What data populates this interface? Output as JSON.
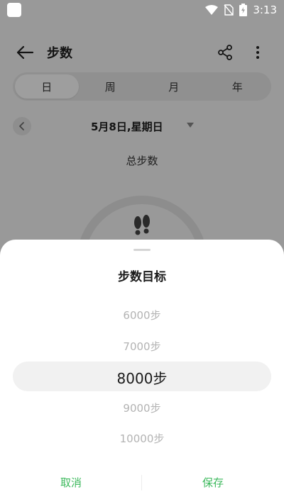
{
  "status_bar": {
    "time": "3:13"
  },
  "app_bar": {
    "title": "步数"
  },
  "tabs": [
    {
      "label": "日",
      "active": true
    },
    {
      "label": "周",
      "active": false
    },
    {
      "label": "月",
      "active": false
    },
    {
      "label": "年",
      "active": false
    }
  ],
  "date": {
    "label": "5月8日,星期日"
  },
  "summary": {
    "total_label": "总步数"
  },
  "sheet": {
    "title": "步数目标",
    "options": [
      "6000步",
      "7000步",
      "8000步",
      "9000步",
      "10000步"
    ],
    "selected": "8000步",
    "cancel_label": "取消",
    "save_label": "保存"
  },
  "colors": {
    "accent": "#3cb95c",
    "dim": "#9a9a9a",
    "sheet": "#ffffff"
  },
  "icons": [
    "back-arrow-icon",
    "share-icon",
    "more-vert-icon",
    "chevron-left-icon",
    "dropdown-triangle-icon",
    "footprints-icon",
    "wifi-icon",
    "no-sim-icon",
    "battery-charging-icon"
  ]
}
